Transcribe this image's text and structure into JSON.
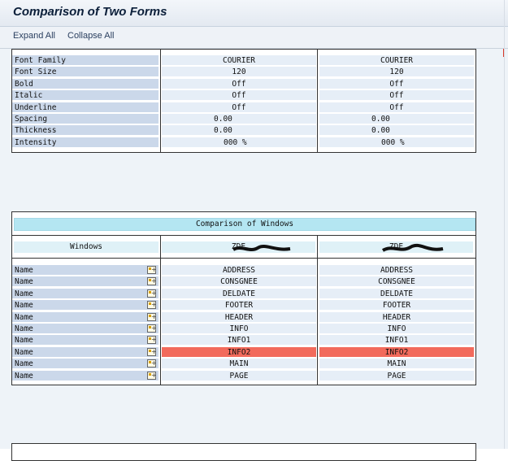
{
  "window": {
    "title": "Comparison of Two Forms"
  },
  "toolbar": {
    "expand_all": "Expand All",
    "collapse_all": "Collapse All"
  },
  "font_table": {
    "rows": [
      {
        "label": "Font Family",
        "a": "COURIER",
        "b": "COURIER"
      },
      {
        "label": "Font Size",
        "a": "120",
        "b": "120"
      },
      {
        "label": "Bold",
        "a": "Off",
        "b": "Off"
      },
      {
        "label": "Italic",
        "a": "Off",
        "b": "Off"
      },
      {
        "label": "Underline",
        "a": "Off",
        "b": "Off"
      },
      {
        "label": "Spacing",
        "a": "0.00",
        "b": "0.00"
      },
      {
        "label": "Thickness",
        "a": "0.00",
        "b": "0.00"
      },
      {
        "label": "Intensity",
        "a": "000 %",
        "b": "000 %"
      }
    ]
  },
  "windows_table": {
    "title": "Comparison of Windows",
    "col_header": "Windows",
    "form_a": "ZDE",
    "form_b": "ZDE",
    "rows": [
      {
        "label": "Name",
        "a": "ADDRESS",
        "b": "ADDRESS",
        "diff": false
      },
      {
        "label": "Name",
        "a": "CONSGNEE",
        "b": "CONSGNEE",
        "diff": false
      },
      {
        "label": "Name",
        "a": "DELDATE",
        "b": "DELDATE",
        "diff": false
      },
      {
        "label": "Name",
        "a": "FOOTER",
        "b": "FOOTER",
        "diff": false
      },
      {
        "label": "Name",
        "a": "HEADER",
        "b": "HEADER",
        "diff": false
      },
      {
        "label": "Name",
        "a": "INFO",
        "b": "INFO",
        "diff": false
      },
      {
        "label": "Name",
        "a": "INFO1",
        "b": "INFO1",
        "diff": false
      },
      {
        "label": "Name",
        "a": "INFO2",
        "b": "INFO2",
        "diff": true
      },
      {
        "label": "Name",
        "a": "MAIN",
        "b": "MAIN",
        "diff": false
      },
      {
        "label": "Name",
        "a": "PAGE",
        "b": "PAGE",
        "diff": false
      }
    ],
    "highlight_color": "#f26a5c"
  }
}
